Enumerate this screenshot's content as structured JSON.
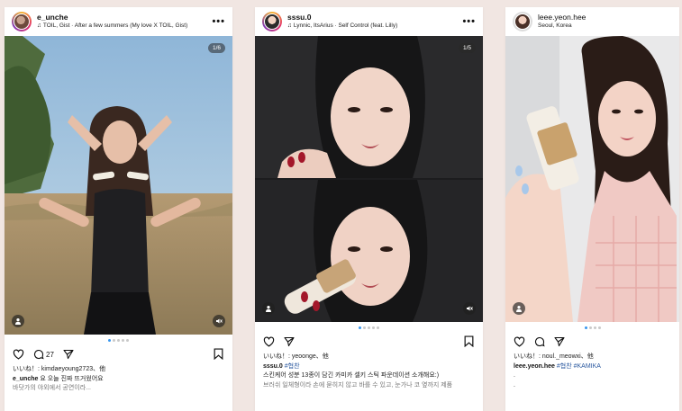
{
  "posts": [
    {
      "username": "e_unche",
      "music": "TOIL, Gist · After a few summers (My love X TOIL, Gist)",
      "counter": "1/6",
      "comment_count": "27",
      "liked_by": "いいね！: kimdaeyoung2723、他",
      "caption_user": "e_unche",
      "caption_text": "요 오늘 진짜 뜨거웠어요",
      "caption_line2": "바닷가의 야외에서 공연이라..."
    },
    {
      "username": "sssu.0",
      "music": "Lynnic, ItsArius · Self Control (feat. Lilly)",
      "counter": "1/5",
      "liked_by": "いいね！: yeoonge、他",
      "caption_user": "sssu.0",
      "caption_hashtag": "#협찬",
      "caption_line2": "스킨케어 성분 13종이 담긴 카미카 셀키 스틱 파운데이션 소개해요:)",
      "caption_line3": "브러쉬 일체형이라 손에 묻히지 않고 바를 수 있고, 눈가나 코 옆까지 제품"
    },
    {
      "username": "leee.yeon.hee",
      "location": "Seoul, Korea",
      "liked_by": "いいね！: noul._meowxi、他",
      "caption_user": "leee.yeon.hee",
      "caption_hashtags": "#협찬 #KAMIKA",
      "caption_dot1": ".",
      "caption_dot2": "."
    }
  ]
}
